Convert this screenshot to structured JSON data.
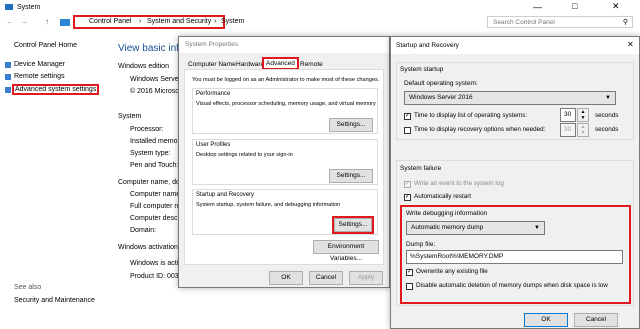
{
  "system_window": {
    "title": "System",
    "breadcrumb": [
      "Control Panel",
      "System and Security",
      "System"
    ],
    "search_placeholder": "Search Control Panel",
    "sidebar": {
      "home": "Control Panel Home",
      "items": [
        "Device Manager",
        "Remote settings",
        "Advanced system settings"
      ],
      "see_also": "See also",
      "security": "Security and Maintenance"
    },
    "main": {
      "heading": "View basic inform",
      "windows_edition": "Windows edition",
      "edition_value": "Windows Server 2",
      "copyright": "© 2016 Microsoft",
      "system_label": "System",
      "processor": "Processor:",
      "installed_memory": "Installed memory",
      "system_type": "System type:",
      "pen_touch": "Pen and Touch:",
      "computer_name_section": "Computer name, dom",
      "computer_name": "Computer name:",
      "full_computer_name": "Full computer name",
      "computer_description": "Computer descrip",
      "domain": "Domain:",
      "activation": "Windows activation",
      "activation_status": "Windows is activat",
      "product_id": "Product ID: 00378"
    }
  },
  "system_properties": {
    "title": "System Properties",
    "tabs": [
      "Computer Name",
      "Hardware",
      "Advanced",
      "Remote"
    ],
    "admin_note": "You must be logged on as an Administrator to make most of these changes.",
    "performance": {
      "title": "Performance",
      "desc": "Visual effects, processor scheduling, memory usage, and virtual memory",
      "button": "Settings..."
    },
    "user_profiles": {
      "title": "User Profiles",
      "desc": "Desktop settings related to your sign-in",
      "button": "Settings..."
    },
    "startup_recovery": {
      "title": "Startup and Recovery",
      "desc": "System startup, system failure, and debugging information",
      "button": "Settings..."
    },
    "env_button": "Environment Variables...",
    "ok": "OK",
    "cancel": "Cancel",
    "apply": "Apply"
  },
  "startup_recovery": {
    "title": "Startup and Recovery",
    "system_startup": "System startup",
    "default_os_label": "Default operating system:",
    "default_os_value": "Windows Server 2016",
    "time_list_label": "Time to display list of operating systems:",
    "time_list_value": "30",
    "time_recovery_label": "Time to display recovery options when needed:",
    "time_recovery_value": "30",
    "seconds": "seconds",
    "system_failure": "System failure",
    "write_event": "Write an event to the system log",
    "auto_restart": "Automatically restart",
    "write_debug": "Write debugging information",
    "dump_type": "Automatic memory dump",
    "dump_file_label": "Dump file:",
    "dump_file_value": "%SystemRoot%\\MEMORY.DMP",
    "overwrite": "Overwrite any existing file",
    "disable_auto_delete": "Disable automatic deletion of memory dumps when disk space is low",
    "ok": "OK",
    "cancel": "Cancel"
  }
}
